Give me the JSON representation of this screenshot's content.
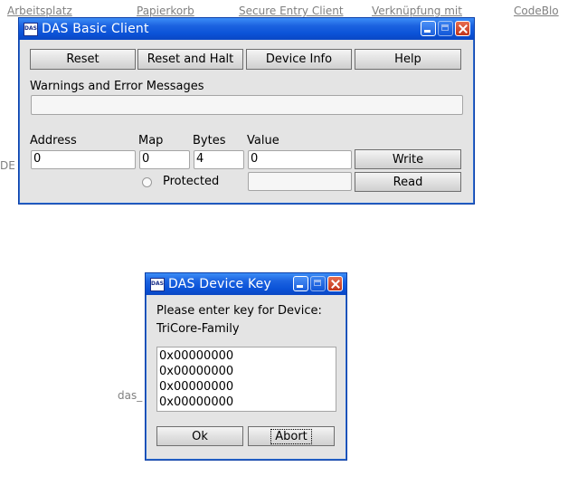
{
  "desktop": {
    "icons": [
      "Arbeitsplatz",
      "Papierkorb",
      "Secure Entry Client",
      "Verknüpfung mit",
      "CodeBlo",
      "DE",
      "das_"
    ]
  },
  "main_window": {
    "title": "DAS Basic Client",
    "buttons": {
      "reset": "Reset",
      "reset_halt": "Reset and Halt",
      "device_info": "Device Info",
      "help": "Help",
      "write": "Write",
      "read": "Read"
    },
    "warnings_label": "Warnings and Error Messages",
    "warnings_value": "",
    "columns": {
      "address": "Address",
      "map": "Map",
      "bytes": "Bytes",
      "value": "Value"
    },
    "fields": {
      "address": "0",
      "map": "0",
      "bytes": "4",
      "value": "0",
      "read_value": ""
    },
    "protected_label": "Protected",
    "protected_checked": false
  },
  "key_dialog": {
    "title": "DAS Device Key",
    "prompt": "Please enter key for Device:",
    "device": "TriCore-Family",
    "keys": [
      "0x00000000",
      "0x00000000",
      "0x00000000",
      "0x00000000"
    ],
    "ok_label": "Ok",
    "abort_label": "Abort"
  },
  "colors": {
    "titlebar": "#0b53d8",
    "window_bg": "#e4e4e4",
    "close_button": "#c1351b"
  }
}
